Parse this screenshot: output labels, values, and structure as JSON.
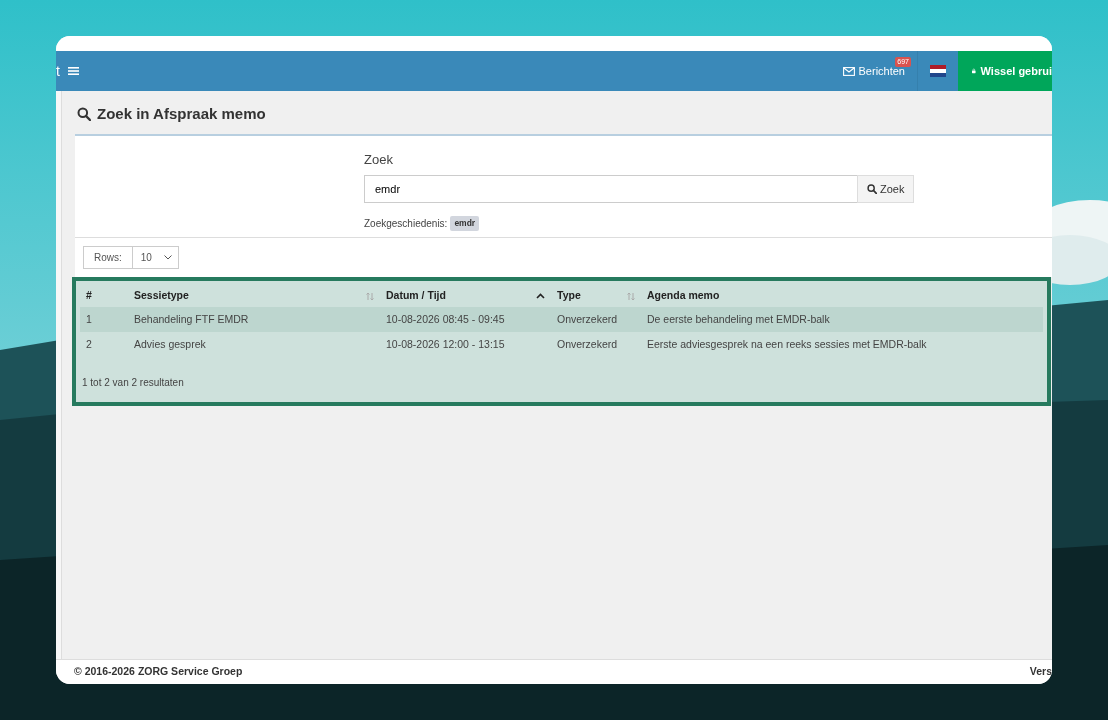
{
  "navbar": {
    "brand_fragment": "t",
    "messages": {
      "label": "Berichten",
      "count": "697"
    },
    "switch_user": "Wissel gebrui"
  },
  "page_title": "Zoek in Afspraak memo",
  "search": {
    "label": "Zoek",
    "value": "emdr",
    "button": "Zoek",
    "history_label": "Zoekgeschiedenis:",
    "history": [
      "emdr"
    ]
  },
  "rows_select": {
    "label": "Rows:",
    "value": "10"
  },
  "table": {
    "columns": [
      {
        "label": "#",
        "sortable": false
      },
      {
        "label": "Sessietype",
        "sortable": true
      },
      {
        "label": "Datum / Tijd",
        "sortable": true,
        "sorted_ascending": true
      },
      {
        "label": "Type",
        "sortable": true
      },
      {
        "label": "Agenda memo",
        "sortable": false
      }
    ],
    "rows": [
      {
        "selected": true,
        "cells": [
          "1",
          "Behandeling FTF EMDR",
          "10-08-2026 08:45 - 09:45",
          "Onverzekerd",
          "De eerste behandeling met EMDR-balk"
        ]
      },
      {
        "selected": false,
        "cells": [
          "2",
          "Advies gesprek",
          "10-08-2026 12:00 - 13:15",
          "Onverzekerd",
          "Eerste adviesgesprek na een reeks sessies met EMDR-balk"
        ]
      }
    ],
    "summary": "1 tot 2 van 2 resultaten"
  },
  "footer": {
    "copyright": "© 2016-2026",
    "company": "ZORG Service Groep",
    "version_fragment": "Vers"
  }
}
